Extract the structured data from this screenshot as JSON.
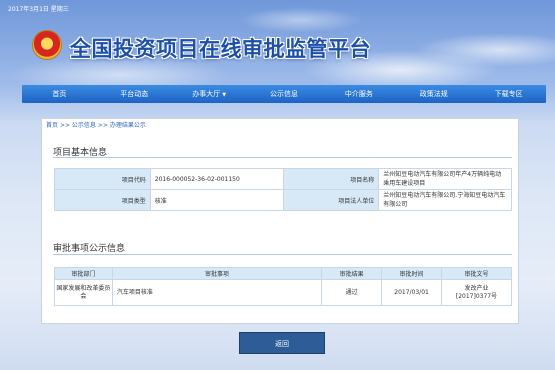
{
  "header": {
    "date": "2017年3月1日 星期三",
    "site_title": "全国投资项目在线审批监管平台"
  },
  "nav": {
    "items": [
      "首页",
      "平台动态",
      "办事大厅",
      "公示信息",
      "中介服务",
      "政策法规",
      "下载专区"
    ],
    "dropdown_caret": "▼"
  },
  "breadcrumb": {
    "home": "首页",
    "sep": ">>",
    "level1": "公示信息",
    "level2": "办理结果公示"
  },
  "basic_info": {
    "title": "项目基本信息",
    "rows": [
      {
        "k1": "项目代码",
        "v1": "2016-000052-36-02-001150",
        "k2": "项目名称",
        "v2": "兰州知豆电动汽车有限公司年产4万辆纯电动乘用车建设项目"
      },
      {
        "k1": "项目类型",
        "v1": "核准",
        "k2": "项目法人单位",
        "v2": "兰州知豆电动汽车有限公司.宁海知豆电动汽车有限公司"
      }
    ]
  },
  "approval": {
    "title": "审批事项公示信息",
    "headers": [
      "审批部门",
      "审批事项",
      "审批结果",
      "审批时间",
      "审批文号"
    ],
    "rows": [
      {
        "dept": "国家发展和改革委员会",
        "item": "汽车项目核准",
        "result": "通过",
        "date": "2017/03/01",
        "doc": "发改产业[2017]0377号"
      }
    ]
  },
  "back_button": "返回",
  "colors": {
    "nav_bg": "#2a74d4",
    "title_text": "#1c4fa8",
    "table_key_bg": "#d7e8f7",
    "button_bg": "#2e5c96"
  }
}
